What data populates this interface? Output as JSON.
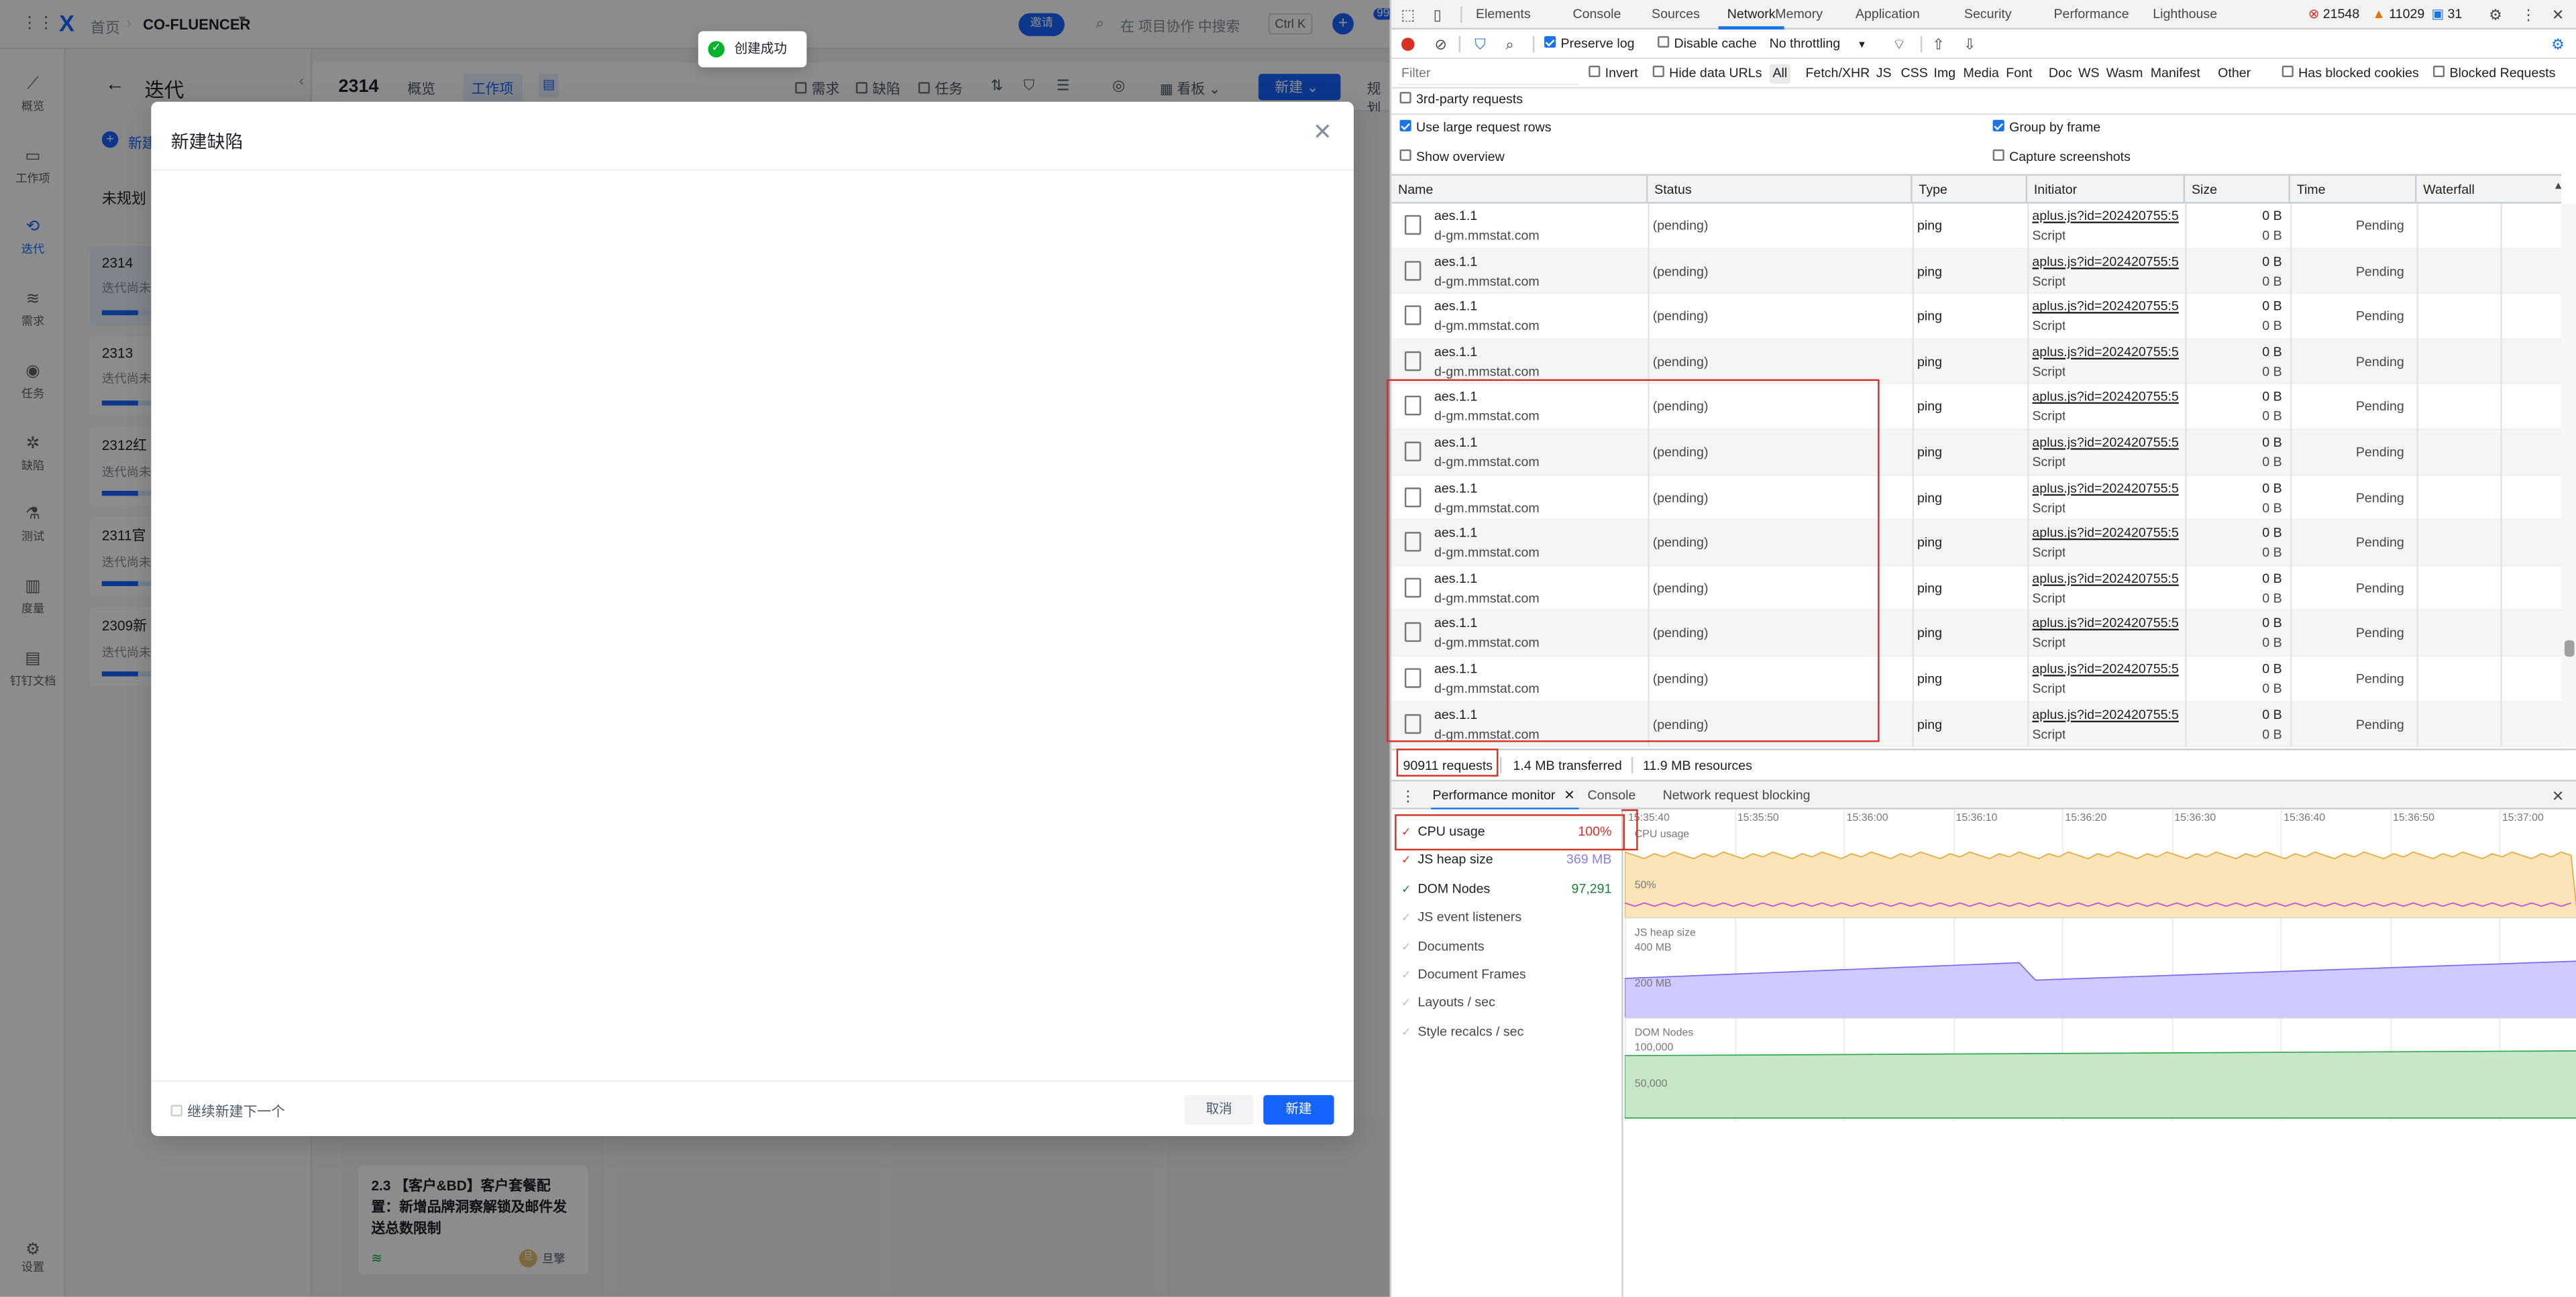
{
  "app": {
    "breadcrumb_home": "首页",
    "project_name": "CO-FLUENCER",
    "invite_button": "邀请",
    "search_placeholder": "在 项目协作 中搜索",
    "shortcut": "Ctrl K",
    "notification_count": "99",
    "nav": [
      {
        "label": "概览",
        "icon": "chart-icon"
      },
      {
        "label": "工作项",
        "icon": "folder-icon"
      },
      {
        "label": "迭代",
        "icon": "iteration-icon"
      },
      {
        "label": "需求",
        "icon": "layers-icon"
      },
      {
        "label": "任务",
        "icon": "task-icon"
      },
      {
        "label": "缺陷",
        "icon": "bug-icon"
      },
      {
        "label": "测试",
        "icon": "flask-icon"
      },
      {
        "label": "度量",
        "icon": "bar-chart-icon"
      },
      {
        "label": "钉钉文档",
        "icon": "doc-icon"
      }
    ],
    "settings_label": "设置",
    "iteration_title": "迭代",
    "new_iteration": "新建",
    "unplanned": "未规划",
    "iterations": [
      {
        "name": "2314",
        "status": "迭代尚未"
      },
      {
        "name": "2313",
        "status": "迭代尚未"
      },
      {
        "name": "2312红",
        "status": "迭代尚未"
      },
      {
        "name": "2311官",
        "status": "迭代尚未"
      },
      {
        "name": "2309新",
        "status": "迭代尚未"
      }
    ],
    "iter_header": {
      "number": "2314",
      "tabs": [
        "概览",
        "工作项"
      ],
      "filters": [
        "需求",
        "缺陷",
        "任务"
      ],
      "view": "看板",
      "new_button": "新建",
      "trailing": "规划"
    },
    "card": {
      "title": "2.3 【客户&BD】客户套餐配置：新增品牌洞察解锁及邮件发送总数限制",
      "avatar_text": "旦",
      "owner": "旦擎"
    }
  },
  "toast": {
    "message": "创建成功"
  },
  "modal": {
    "title": "新建缺陷",
    "continue_label": "继续新建下一个",
    "cancel": "取消",
    "submit": "新建"
  },
  "devtools": {
    "tabs": [
      "Elements",
      "Console",
      "Sources",
      "Network",
      "Memory",
      "Application",
      "Security",
      "Performance",
      "Lighthouse"
    ],
    "active_tab": "Network",
    "errors": "21548",
    "warnings": "11029",
    "messages": "31",
    "toolbar": {
      "preserve_log": "Preserve log",
      "disable_cache": "Disable cache",
      "throttling": "No throttling"
    },
    "filter": {
      "placeholder": "Filter",
      "invert": "Invert",
      "hide_data_urls": "Hide data URLs",
      "types": [
        "All",
        "Fetch/XHR",
        "JS",
        "CSS",
        "Img",
        "Media",
        "Font",
        "Doc",
        "WS",
        "Wasm",
        "Manifest",
        "Other"
      ],
      "has_blocked_cookies": "Has blocked cookies",
      "blocked_requests": "Blocked Requests",
      "third_party": "3rd-party requests"
    },
    "options": {
      "large_rows": "Use large request rows",
      "group_by_frame": "Group by frame",
      "show_overview": "Show overview",
      "capture_screenshots": "Capture screenshots"
    },
    "columns": [
      "Name",
      "Status",
      "Type",
      "Initiator",
      "Size",
      "Time",
      "Waterfall"
    ],
    "rows": [
      {
        "name": "aes.1.1",
        "domain": "d-gm.mmstat.com",
        "status": "(pending)",
        "type": "ping",
        "initiator": "aplus.js?id=202420755:5",
        "initiator_type": "Script",
        "size": "0 B",
        "size2": "0 B",
        "time": "Pending"
      },
      {
        "name": "aes.1.1",
        "domain": "d-gm.mmstat.com",
        "status": "(pending)",
        "type": "ping",
        "initiator": "aplus.js?id=202420755:5",
        "initiator_type": "Script",
        "size": "0 B",
        "size2": "0 B",
        "time": "Pending"
      },
      {
        "name": "aes.1.1",
        "domain": "d-gm.mmstat.com",
        "status": "(pending)",
        "type": "ping",
        "initiator": "aplus.js?id=202420755:5",
        "initiator_type": "Script",
        "size": "0 B",
        "size2": "0 B",
        "time": "Pending"
      },
      {
        "name": "aes.1.1",
        "domain": "d-gm.mmstat.com",
        "status": "(pending)",
        "type": "ping",
        "initiator": "aplus.js?id=202420755:5",
        "initiator_type": "Script",
        "size": "0 B",
        "size2": "0 B",
        "time": "Pending"
      },
      {
        "name": "aes.1.1",
        "domain": "d-gm.mmstat.com",
        "status": "(pending)",
        "type": "ping",
        "initiator": "aplus.js?id=202420755:5",
        "initiator_type": "Script",
        "size": "0 B",
        "size2": "0 B",
        "time": "Pending"
      },
      {
        "name": "aes.1.1",
        "domain": "d-gm.mmstat.com",
        "status": "(pending)",
        "type": "ping",
        "initiator": "aplus.js?id=202420755:5",
        "initiator_type": "Script",
        "size": "0 B",
        "size2": "0 B",
        "time": "Pending"
      },
      {
        "name": "aes.1.1",
        "domain": "d-gm.mmstat.com",
        "status": "(pending)",
        "type": "ping",
        "initiator": "aplus.js?id=202420755:5",
        "initiator_type": "Script",
        "size": "0 B",
        "size2": "0 B",
        "time": "Pending"
      },
      {
        "name": "aes.1.1",
        "domain": "d-gm.mmstat.com",
        "status": "(pending)",
        "type": "ping",
        "initiator": "aplus.js?id=202420755:5",
        "initiator_type": "Script",
        "size": "0 B",
        "size2": "0 B",
        "time": "Pending"
      },
      {
        "name": "aes.1.1",
        "domain": "d-gm.mmstat.com",
        "status": "(pending)",
        "type": "ping",
        "initiator": "aplus.js?id=202420755:5",
        "initiator_type": "Script",
        "size": "0 B",
        "size2": "0 B",
        "time": "Pending"
      },
      {
        "name": "aes.1.1",
        "domain": "d-gm.mmstat.com",
        "status": "(pending)",
        "type": "ping",
        "initiator": "aplus.js?id=202420755:5",
        "initiator_type": "Script",
        "size": "0 B",
        "size2": "0 B",
        "time": "Pending"
      },
      {
        "name": "aes.1.1",
        "domain": "d-gm.mmstat.com",
        "status": "(pending)",
        "type": "ping",
        "initiator": "aplus.js?id=202420755:5",
        "initiator_type": "Script",
        "size": "0 B",
        "size2": "0 B",
        "time": "Pending"
      },
      {
        "name": "aes.1.1",
        "domain": "d-gm.mmstat.com",
        "status": "(pending)",
        "type": "ping",
        "initiator": "aplus.js?id=202420755:5",
        "initiator_type": "Script",
        "size": "0 B",
        "size2": "0 B",
        "time": "Pending"
      }
    ],
    "summary": {
      "requests": "90911 requests",
      "transferred": "1.4 MB transferred",
      "resources": "11.9 MB resources"
    },
    "drawer_tabs": [
      "Performance monitor",
      "Console",
      "Network request blocking"
    ],
    "metrics": [
      {
        "label": "CPU usage",
        "value": "100%",
        "on": true,
        "color": "#d93025"
      },
      {
        "label": "JS heap size",
        "value": "369 MB",
        "on": true,
        "color": "#8c7cf0"
      },
      {
        "label": "DOM Nodes",
        "value": "97,291",
        "on": true,
        "color": "#188038"
      },
      {
        "label": "JS event listeners",
        "value": "",
        "on": false,
        "color": ""
      },
      {
        "label": "Documents",
        "value": "",
        "on": false,
        "color": ""
      },
      {
        "label": "Document Frames",
        "value": "",
        "on": false,
        "color": ""
      },
      {
        "label": "Layouts / sec",
        "value": "",
        "on": false,
        "color": ""
      },
      {
        "label": "Style recalcs / sec",
        "value": "",
        "on": false,
        "color": ""
      }
    ],
    "time_ticks": [
      "15:35:40",
      "15:35:50",
      "15:36:00",
      "15:36:10",
      "15:36:20",
      "15:36:30",
      "15:36:40",
      "15:36:50",
      "15:37:00"
    ],
    "charts": {
      "cpu": {
        "title": "CPU usage",
        "label_50": "50%"
      },
      "heap": {
        "title": "JS heap size",
        "label_400": "400 MB",
        "label_200": "200 MB"
      },
      "dom": {
        "title": "DOM Nodes",
        "label_100k": "100,000",
        "label_50k": "50,000"
      }
    },
    "colors": {
      "accent": "#1a73e8",
      "error": "#d93025",
      "cpu_fill": "#fbe4b8",
      "heap_fill": "#cfcaff",
      "dom_fill": "#c6e8c6"
    }
  }
}
